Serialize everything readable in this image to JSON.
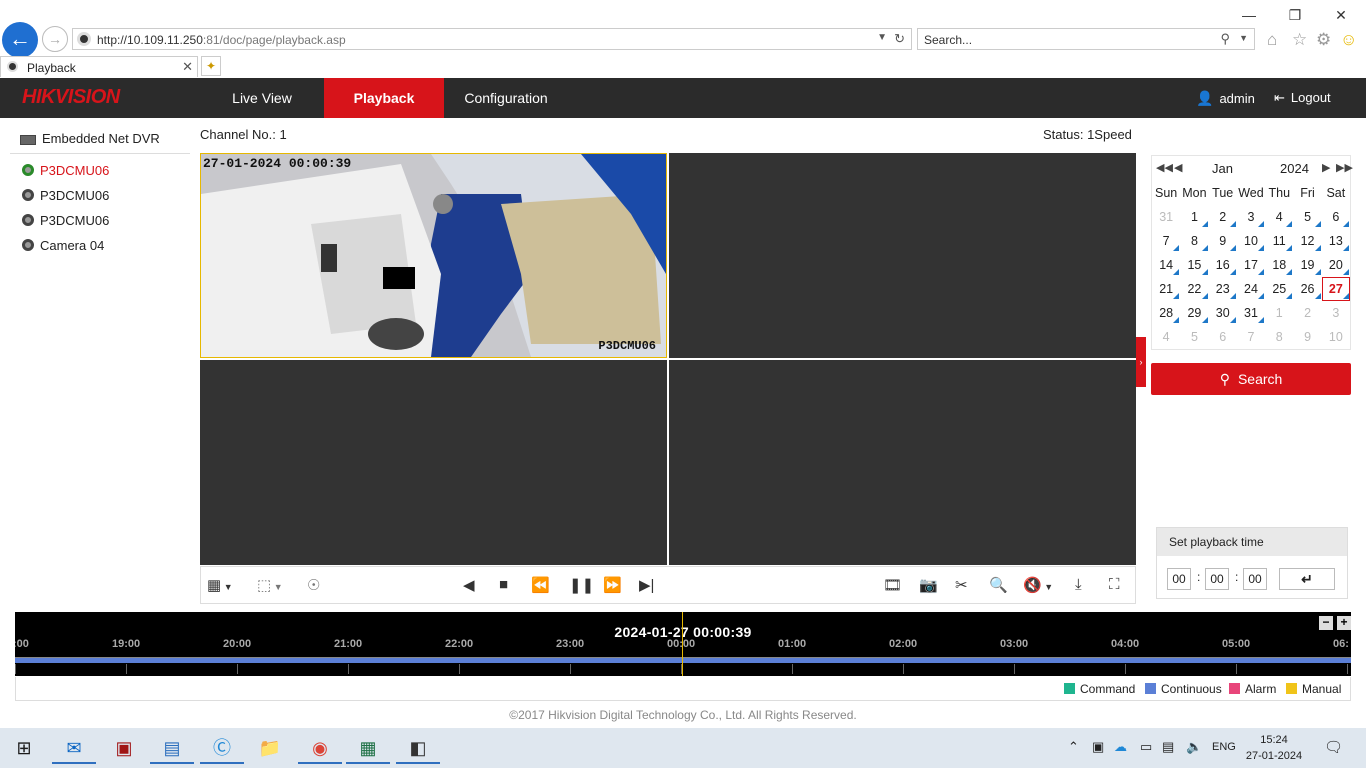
{
  "browser": {
    "url_host": "http://10.109.11.250",
    "url_rest": ":81/doc/page/playback.asp",
    "search_placeholder": "Search...",
    "tab_title": "Playback"
  },
  "header": {
    "logo": "HIKVISION",
    "nav": [
      "Live View",
      "Playback",
      "Configuration"
    ],
    "user": "admin",
    "logout": "Logout"
  },
  "tree": {
    "root": "Embedded Net DVR",
    "cameras": [
      "P3DCMU06",
      "P3DCMU06",
      "P3DCMU06",
      "Camera 04"
    ]
  },
  "channel": {
    "label": "Channel No.: 1",
    "status": "Status: 1Speed"
  },
  "video": {
    "osd_time": "27-01-2024 00:00:39",
    "osd_name": "P3DCMU06"
  },
  "calendar": {
    "month": "Jan",
    "year": "2024",
    "weekdays": [
      "Sun",
      "Mon",
      "Tue",
      "Wed",
      "Thu",
      "Fri",
      "Sat"
    ],
    "weeks": [
      [
        "31",
        "1",
        "2",
        "3",
        "4",
        "5",
        "6"
      ],
      [
        "7",
        "8",
        "9",
        "10",
        "11",
        "12",
        "13"
      ],
      [
        "14",
        "15",
        "16",
        "17",
        "18",
        "19",
        "20"
      ],
      [
        "21",
        "22",
        "23",
        "24",
        "25",
        "26",
        "27"
      ],
      [
        "28",
        "29",
        "30",
        "31",
        "1",
        "2",
        "3"
      ],
      [
        "4",
        "5",
        "6",
        "7",
        "8",
        "9",
        "10"
      ]
    ],
    "selected_day": "27",
    "search_label": "Search"
  },
  "playback_time": {
    "title": "Set playback time",
    "hh": "00",
    "mm": "00",
    "ss": "00"
  },
  "timeline": {
    "current": "2024-01-27 00:00:39",
    "labels": [
      ":00",
      "19:00",
      "20:00",
      "21:00",
      "22:00",
      "23:00",
      "00:00",
      "01:00",
      "02:00",
      "03:00",
      "04:00",
      "05:00",
      "06:"
    ]
  },
  "legend": {
    "items": [
      {
        "label": "Command",
        "color": "#1fb58f"
      },
      {
        "label": "Continuous",
        "color": "#5b7fd6"
      },
      {
        "label": "Alarm",
        "color": "#e8457a"
      },
      {
        "label": "Manual",
        "color": "#f0c419"
      }
    ]
  },
  "footer": {
    "copyright": "©2017 Hikvision Digital Technology Co., Ltd. All Rights Reserved."
  },
  "taskbar": {
    "lang": "ENG",
    "time": "15:24",
    "date": "27-01-2024"
  }
}
